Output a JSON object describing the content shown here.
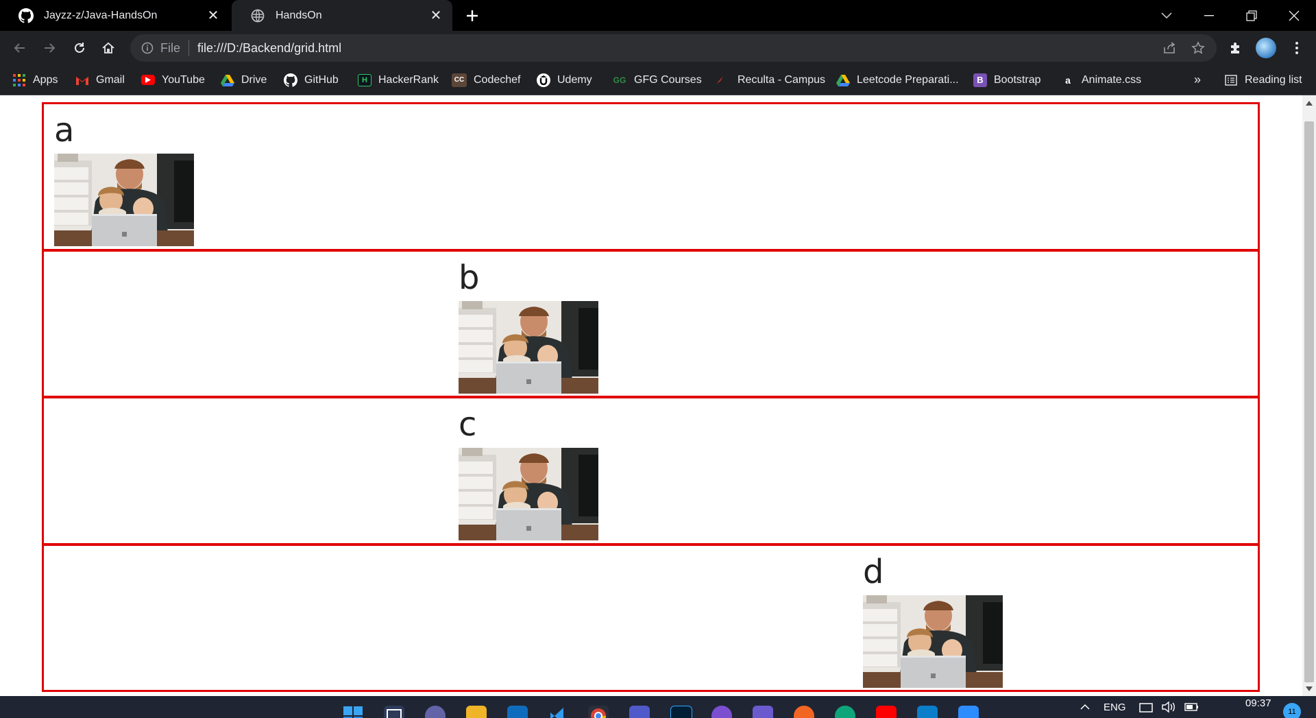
{
  "browser": {
    "tabs": [
      {
        "title": "Jayzz-z/Java-HandsOn",
        "favicon": "github-icon",
        "active": false
      },
      {
        "title": "HandsOn",
        "favicon": "globe-icon",
        "active": true
      }
    ],
    "omnibox": {
      "scheme_label": "File",
      "url": "file:///D:/Backend/grid.html"
    },
    "bookmarks": [
      {
        "label": "Apps",
        "icon": "apps-grid-icon"
      },
      {
        "label": "Gmail",
        "icon": "gmail-icon"
      },
      {
        "label": "YouTube",
        "icon": "youtube-icon"
      },
      {
        "label": "Drive",
        "icon": "drive-icon"
      },
      {
        "label": "GitHub",
        "icon": "github-icon"
      },
      {
        "label": "HackerRank",
        "icon": "hackerrank-icon"
      },
      {
        "label": "Codechef",
        "icon": "codechef-icon"
      },
      {
        "label": "Udemy",
        "icon": "udemy-icon"
      },
      {
        "label": "GFG Courses",
        "icon": "gfg-icon"
      },
      {
        "label": "Reculta - Campus",
        "icon": "reculta-icon"
      },
      {
        "label": "Leetcode Preparati...",
        "icon": "drive-icon"
      },
      {
        "label": "Bootstrap",
        "icon": "bootstrap-icon"
      },
      {
        "label": "Animate.css",
        "icon": "animate-icon"
      }
    ],
    "overflow_label": "»",
    "reading_list_label": "Reading list",
    "bootstrap_glyph": "B",
    "animate_glyph": "a",
    "hr_glyph": "H",
    "cc_glyph": "CC",
    "gfg_glyph": "GG"
  },
  "page": {
    "items": [
      {
        "letter": "a",
        "image": "family-laptop-photo"
      },
      {
        "letter": "b",
        "image": "family-laptop-photo"
      },
      {
        "letter": "c",
        "image": "family-laptop-photo"
      },
      {
        "letter": "d",
        "image": "family-laptop-photo"
      }
    ]
  },
  "taskbar": {
    "language": "ENG",
    "time": "09:37",
    "notification_count": "11"
  },
  "colors": {
    "grid_border": "#e00000",
    "chrome_dark": "#202124",
    "tabstrip": "#000000",
    "taskbar": "#1f2533"
  }
}
